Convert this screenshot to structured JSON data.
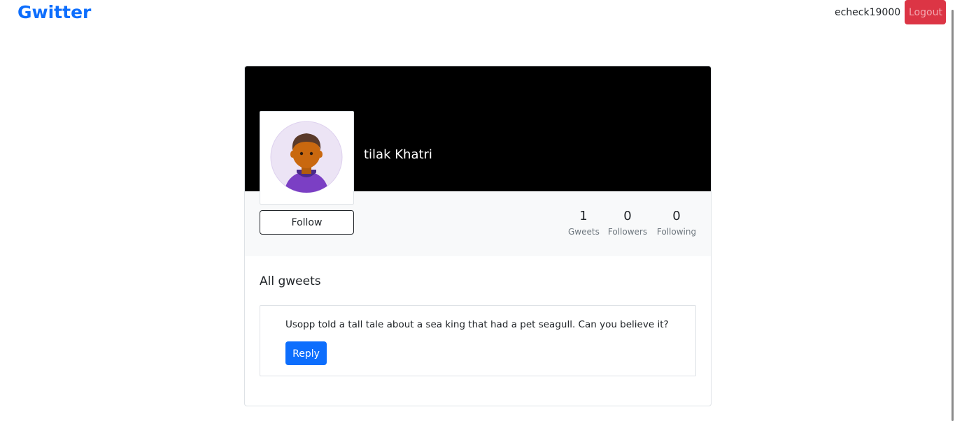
{
  "navbar": {
    "brand": "Gwitter",
    "username": "echeck19000",
    "logout_label": "Logout"
  },
  "profile": {
    "name": "tilak Khatri",
    "follow_label": "Follow",
    "avatar_icon": "person-avatar-icon",
    "stats": {
      "gweets": {
        "value": "1",
        "label": "Gweets"
      },
      "followers": {
        "value": "0",
        "label": "Followers"
      },
      "following": {
        "value": "0",
        "label": "Following"
      }
    }
  },
  "feed": {
    "title": "All gweets",
    "gweets": [
      {
        "text": "Usopp told a tall tale about a sea king that had a pet seagull. Can you believe it?",
        "reply_label": "Reply"
      }
    ]
  },
  "colors": {
    "brand": "#0d6efd",
    "logout": "#dc3545",
    "banner": "#000000",
    "reply": "#0d6efd"
  }
}
